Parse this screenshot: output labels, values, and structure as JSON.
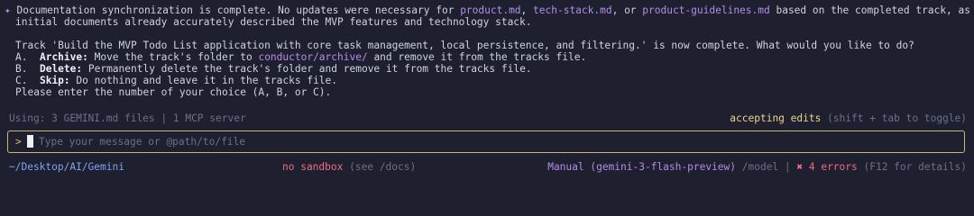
{
  "message": {
    "bullet": "✦",
    "p1_prefix": "Documentation synchronization is complete. No updates were necessary for ",
    "file1": "product.md",
    "sep1": ", ",
    "file2": "tech-stack.md",
    "sep2": ", or ",
    "file3": "product-guidelines.md",
    "p1_suffix": " based on the completed track, as the",
    "p1_line2": "initial documents already accurately described the MVP features and technology stack.",
    "p2": "Track 'Build the MVP Todo List application with core task management, local persistence, and filtering.' is now complete. What would you like to do?",
    "options": [
      {
        "letter": "A.",
        "name": "Archive:",
        "pre": " Move the track's folder to ",
        "path": "conductor/archive/",
        "post": " and remove it from the tracks file."
      },
      {
        "letter": "B.",
        "name": "Delete:",
        "text": " Permanently delete the track's folder and remove it from the tracks file."
      },
      {
        "letter": "C.",
        "name": "Skip:",
        "text": " Do nothing and leave it in the tracks file."
      }
    ],
    "closing": "Please enter the number of your choice (A, B, or C)."
  },
  "context_bar": {
    "using": "Using: 3 GEMINI.md files | 1 MCP server",
    "mode": "accepting edits",
    "mode_hint": " (shift + tab to toggle)"
  },
  "input": {
    "prompt": ">",
    "placeholder": "Type your message or @path/to/file"
  },
  "status": {
    "path": "~/Desktop/AI/Gemini",
    "sandbox": "no sandbox",
    "sandbox_hint": " (see /docs)",
    "model": "Manual (gemini-3-flash-preview)",
    "model_cmd": " /model",
    "divider": " | ",
    "errors": "✖ 4 errors",
    "errors_hint": " (F12 for details)"
  },
  "colors": {
    "background": "#1e2030",
    "accent_purple": "#b48ce8",
    "mode_yellow": "#f0d38a",
    "error_red": "#ef6b80",
    "path_blue": "#7fa3f0",
    "input_border": "#c8b97a"
  }
}
